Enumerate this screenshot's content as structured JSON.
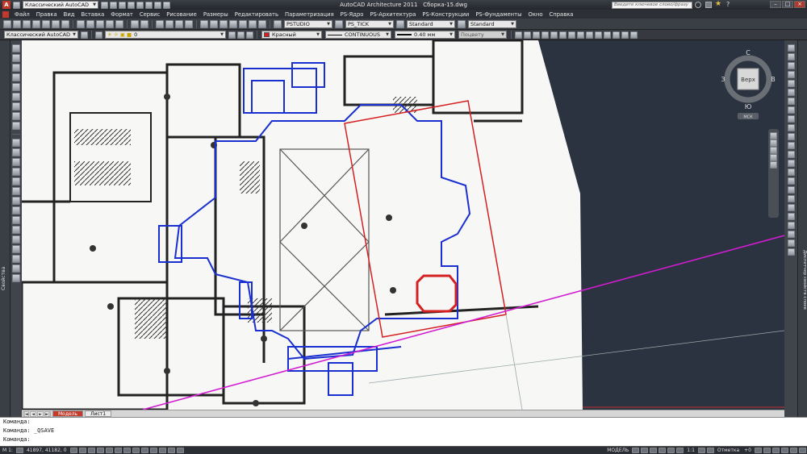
{
  "window": {
    "app_icon": "autocad-a-icon",
    "workspace_label": "Классический AutoCAD",
    "title": "AutoCAD Architecture 2011",
    "filename": "Сборка-15.dwg",
    "search_placeholder": "Введите ключевое слово/фразу"
  },
  "menu": [
    "Файл",
    "Правка",
    "Вид",
    "Вставка",
    "Формат",
    "Сервис",
    "Рисование",
    "Размеры",
    "Редактировать",
    "Параметризация",
    "PS-Ядро",
    "PS-Архитектура",
    "PS-Конструкции",
    "PS-Фундаменты",
    "Окно",
    "Справка"
  ],
  "toolbar1": {
    "textstyle": "PSTUDIO",
    "dimstyle": "PS_TICK",
    "tablestyle": "Standard",
    "mleaderstyle": "Standard"
  },
  "toolbar2": {
    "workspace": "Классический AutoCAD",
    "layer": "0",
    "color": "Красный",
    "color_swatch": "#d42020",
    "linetype": "CONTINUOUS",
    "lineweight": "0.40 мм",
    "plotstyle": "Поцвету"
  },
  "sidepanels": {
    "left": "Свойства",
    "right": "Диспетчер свойств слоев"
  },
  "viewcube": {
    "north": "С",
    "south": "Ю",
    "west": "З",
    "east": "В",
    "face": "Верх",
    "wcs": "МСК"
  },
  "layout_tabs": [
    "Модель",
    "Лист1"
  ],
  "command_lines": [
    "Команда:",
    "Команда:  _QSAVE",
    "Команда:"
  ],
  "status": {
    "coords": "41897, 41182, 0",
    "space": "МОДЕЛЬ",
    "scale": "1:1",
    "elevation_label": "Отметка",
    "elevation_value": "+0"
  },
  "colors": {
    "background": "#2c3340",
    "plan_blue": "#1a2fd0",
    "plan_red": "#d42020",
    "magenta": "#d21cd2"
  }
}
